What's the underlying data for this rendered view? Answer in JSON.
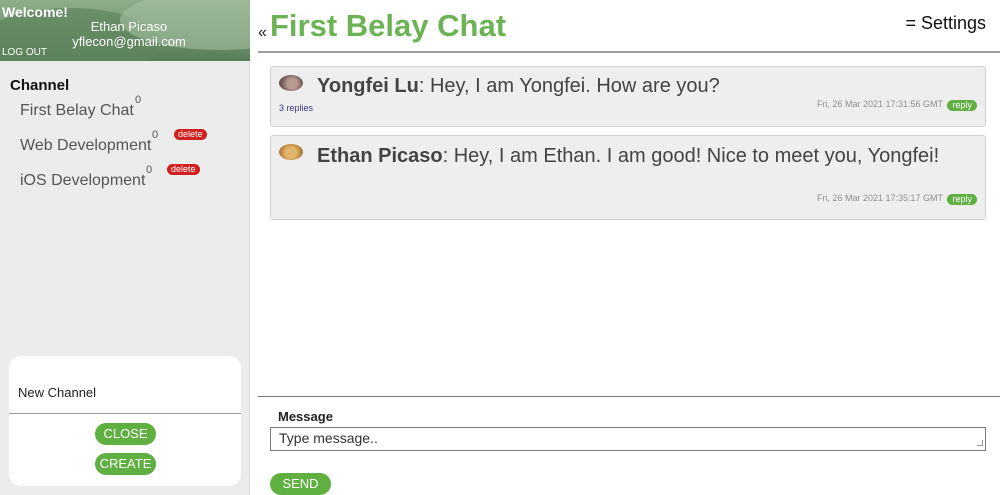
{
  "profile": {
    "welcome": "Welcome!",
    "name": "Ethan Picaso",
    "email": "yflecon@gmail.com",
    "logout": "LOG OUT"
  },
  "channels": {
    "heading": "Channel",
    "items": [
      {
        "name": "First Belay Chat",
        "count": "0",
        "delete": ""
      },
      {
        "name": "Web Development",
        "count": "0",
        "delete": "delete"
      },
      {
        "name": "iOS Development",
        "count": "0",
        "delete": "delete"
      }
    ]
  },
  "new_channel": {
    "placeholder": "New Channel",
    "close": "CLOSE",
    "create": "CREATE"
  },
  "header": {
    "collapse": "«",
    "title": "First Belay Chat",
    "settings": "= Settings"
  },
  "messages": [
    {
      "author": "Yongfei Lu",
      "text": ": Hey, I am Yongfei. How are you?",
      "replies": "3 replies",
      "timestamp": "Fri, 26 Mar 2021 17:31:56 GMT",
      "reply": "reply",
      "avatar_icon": "user-avatar-icon"
    },
    {
      "author": "Ethan Picaso",
      "text": ": Hey, I am Ethan. I am good! Nice to meet you, Yongfei!",
      "replies": "",
      "timestamp": "Fri, 26 Mar 2021 17:35:17 GMT",
      "reply": "reply",
      "avatar_icon": "user-avatar-icon"
    }
  ],
  "composer": {
    "label": "Message",
    "placeholder": "Type message..",
    "send": "SEND"
  },
  "colors": {
    "accent": "#6cb355",
    "button_green": "#5fb040",
    "delete_red": "#d21f1f",
    "sidebar_bg": "#ececec"
  }
}
